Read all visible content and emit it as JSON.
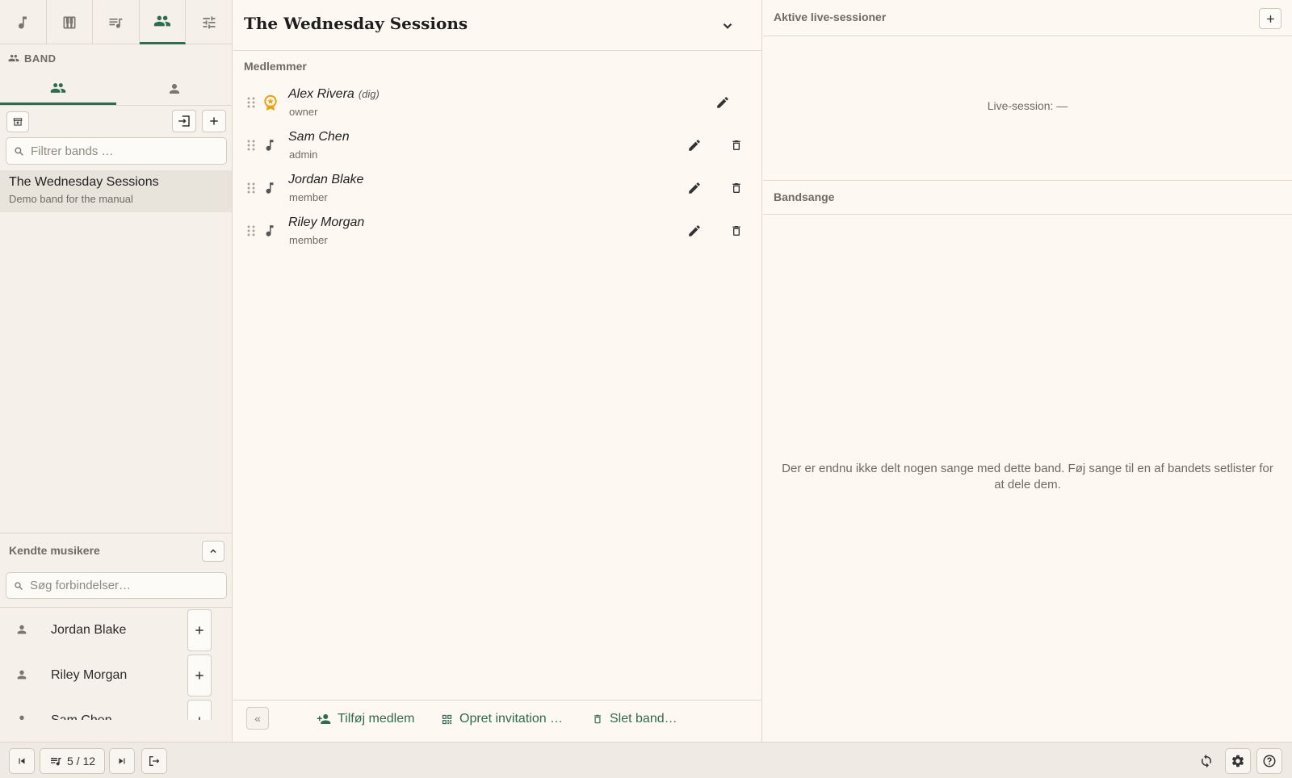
{
  "app": {
    "nav_tabs": [
      {
        "icon": "music-note-icon",
        "active": false
      },
      {
        "icon": "piano-icon",
        "active": false
      },
      {
        "icon": "playlist-icon",
        "active": false
      },
      {
        "icon": "people-icon",
        "active": true
      },
      {
        "icon": "sliders-icon",
        "active": false
      }
    ]
  },
  "sidebar": {
    "section_title": "BAND",
    "band_filter_placeholder": "Filtrer bands …",
    "bands": [
      {
        "name": "The Wednesday Sessions",
        "description": "Demo band for the manual",
        "selected": true
      }
    ],
    "known_musicians_title": "Kendte musikere",
    "connections_placeholder": "Søg forbindelser…",
    "musicians": [
      {
        "name": "Jordan Blake"
      },
      {
        "name": "Riley Morgan"
      },
      {
        "name": "Sam Chen"
      }
    ]
  },
  "band": {
    "title": "The Wednesday Sessions",
    "members_label": "Medlemmer",
    "members": [
      {
        "name": "Alex Rivera",
        "self_tag": "(dig)",
        "role": "owner",
        "icon": "owner-badge-icon",
        "can_delete": false
      },
      {
        "name": "Sam Chen",
        "self_tag": "",
        "role": "admin",
        "icon": "music-note-icon",
        "can_delete": true
      },
      {
        "name": "Jordan Blake",
        "self_tag": "",
        "role": "member",
        "icon": "music-note-icon",
        "can_delete": true
      },
      {
        "name": "Riley Morgan",
        "self_tag": "",
        "role": "member",
        "icon": "music-note-icon",
        "can_delete": true
      }
    ],
    "actions": {
      "add_member": "Tilføj medlem",
      "create_invitation": "Opret invitation …",
      "delete_band": "Slet band…"
    }
  },
  "right": {
    "live_sessions_title": "Aktive live-sessioner",
    "live_session_status": "Live-session: —",
    "band_songs_title": "Bandsange",
    "empty_songs_message": "Der er endnu ikke delt nogen sange med dette band. Føj sange til en af bandets setlister for at dele dem."
  },
  "bottombar": {
    "progress": "5 / 12"
  },
  "colors": {
    "accent": "#2f6b4f",
    "owner_badge": "#e8a317",
    "background": "#fdf8f2",
    "sidebar_bg": "#f5f1ea"
  }
}
